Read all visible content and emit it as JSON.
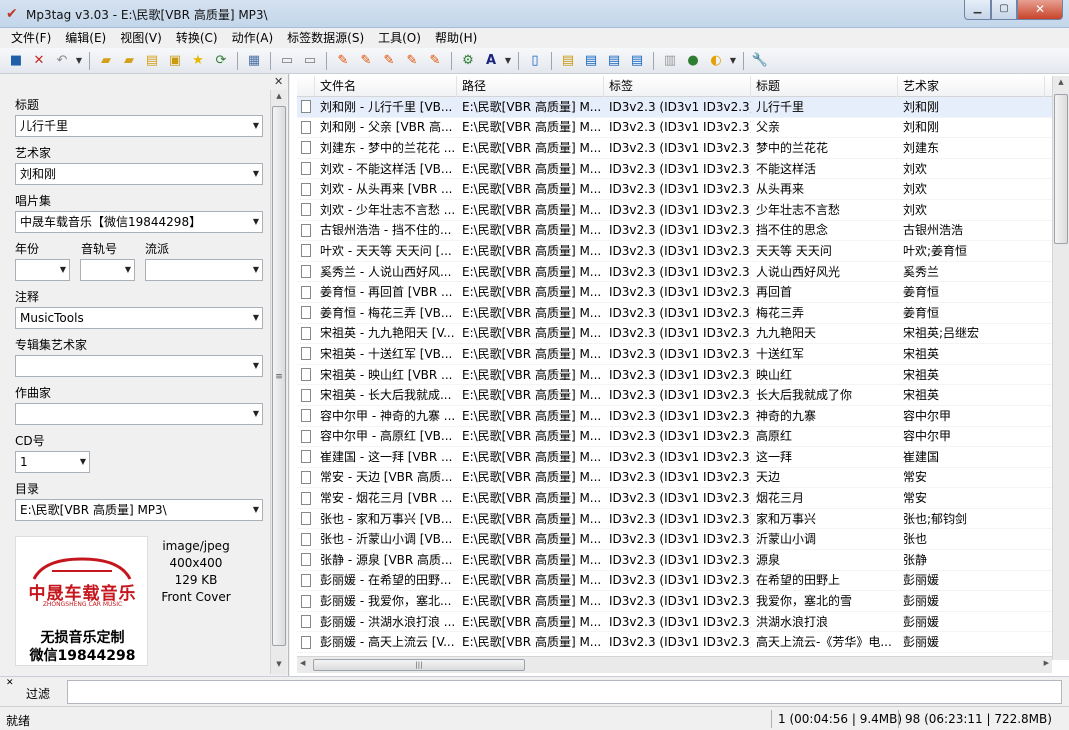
{
  "window": {
    "title": "Mp3tag v3.03 - E:\\民歌[VBR 高质量] MP3\\",
    "icon": "mp3tag-check-icon"
  },
  "menu": [
    "文件(F)",
    "编辑(E)",
    "视图(V)",
    "转换(C)",
    "动作(A)",
    "标签数据源(S)",
    "工具(O)",
    "帮助(H)"
  ],
  "toolbar": {
    "icons": [
      "save-icon",
      "remove-tag-icon",
      "undo-icon",
      "open-folder-icon",
      "add-folder-icon",
      "save-playlist-icon",
      "favorites-icon",
      "refresh-icon",
      "columns-icon",
      "tag-filename-icon",
      "filename-tag-icon",
      "text-file-tag-icon",
      "tag-text-icon",
      "actions-icon",
      "auto-numbering-icon",
      "case-conversion-icon",
      "export-icon",
      "tag-sources-icon",
      "freedb-icon",
      "amazon-icon",
      "discogs-icon",
      "print-icon",
      "web-icon",
      "musicbrainz-icon",
      "settings-icon"
    ]
  },
  "tag_panel": {
    "title_label": "标题",
    "title_value": "儿行千里",
    "artist_label": "艺术家",
    "artist_value": "刘和刚",
    "album_label": "唱片集",
    "album_value": "中晟车载音乐【微信19844298】",
    "year_label": "年份",
    "year_value": "",
    "track_label": "音轨号",
    "track_value": "",
    "genre_label": "流派",
    "genre_value": "",
    "comment_label": "注释",
    "comment_value": "MusicTools",
    "album_artist_label": "专辑集艺术家",
    "album_artist_value": "",
    "composer_label": "作曲家",
    "composer_value": "",
    "disc_label": "CD号",
    "disc_value": "1",
    "dir_label": "目录",
    "dir_value": "E:\\民歌[VBR 高质量] MP3\\",
    "cover": {
      "brand": "中晟车载音乐",
      "brand_sub": "ZHONGSHENG CAR MUSIC",
      "line1": "无损音乐定制",
      "line2": "微信19844298",
      "mime": "image/jpeg",
      "dimensions": "400x400",
      "size": "129 KB",
      "type": "Front Cover"
    }
  },
  "file_list": {
    "columns": [
      "文件名",
      "路径",
      "标签",
      "标题",
      "艺术家"
    ],
    "rows": [
      {
        "file": "刘和刚 - 儿行千里 [VB...",
        "path": "E:\\民歌[VBR 高质量] M...",
        "tag": "ID3v2.3 (ID3v1 ID3v2.3)",
        "title": "儿行千里",
        "artist": "刘和刚",
        "selected": true
      },
      {
        "file": "刘和刚 - 父亲 [VBR 高...",
        "path": "E:\\民歌[VBR 高质量] M...",
        "tag": "ID3v2.3 (ID3v1 ID3v2.3)",
        "title": "父亲",
        "artist": "刘和刚"
      },
      {
        "file": "刘建东 - 梦中的兰花花 ...",
        "path": "E:\\民歌[VBR 高质量] M...",
        "tag": "ID3v2.3 (ID3v1 ID3v2.3)",
        "title": "梦中的兰花花",
        "artist": "刘建东"
      },
      {
        "file": "刘欢 - 不能这样活 [VB...",
        "path": "E:\\民歌[VBR 高质量] M...",
        "tag": "ID3v2.3 (ID3v1 ID3v2.3)",
        "title": "不能这样活",
        "artist": "刘欢"
      },
      {
        "file": "刘欢 - 从头再来 [VBR ...",
        "path": "E:\\民歌[VBR 高质量] M...",
        "tag": "ID3v2.3 (ID3v1 ID3v2.3)",
        "title": "从头再来",
        "artist": "刘欢"
      },
      {
        "file": "刘欢 - 少年壮志不言愁 ...",
        "path": "E:\\民歌[VBR 高质量] M...",
        "tag": "ID3v2.3 (ID3v1 ID3v2.3)",
        "title": "少年壮志不言愁",
        "artist": "刘欢"
      },
      {
        "file": "古银州浩浩 - 挡不住的...",
        "path": "E:\\民歌[VBR 高质量] M...",
        "tag": "ID3v2.3 (ID3v1 ID3v2.3)",
        "title": "挡不住的思念",
        "artist": "古银州浩浩"
      },
      {
        "file": "叶欢 - 天天等 天天问 [...",
        "path": "E:\\民歌[VBR 高质量] M...",
        "tag": "ID3v2.3 (ID3v1 ID3v2.3)",
        "title": "天天等 天天问",
        "artist": "叶欢;姜育恒"
      },
      {
        "file": "奚秀兰 - 人说山西好风...",
        "path": "E:\\民歌[VBR 高质量] M...",
        "tag": "ID3v2.3 (ID3v1 ID3v2.3)",
        "title": "人说山西好风光",
        "artist": "奚秀兰"
      },
      {
        "file": "姜育恒 - 再回首 [VBR ...",
        "path": "E:\\民歌[VBR 高质量] M...",
        "tag": "ID3v2.3 (ID3v1 ID3v2.3)",
        "title": "再回首",
        "artist": "姜育恒"
      },
      {
        "file": "姜育恒 - 梅花三弄 [VB...",
        "path": "E:\\民歌[VBR 高质量] M...",
        "tag": "ID3v2.3 (ID3v1 ID3v2.3)",
        "title": "梅花三弄",
        "artist": "姜育恒"
      },
      {
        "file": "宋祖英 - 九九艳阳天 [V...",
        "path": "E:\\民歌[VBR 高质量] M...",
        "tag": "ID3v2.3 (ID3v1 ID3v2.3)",
        "title": "九九艳阳天",
        "artist": "宋祖英;吕继宏"
      },
      {
        "file": "宋祖英 - 十送红军 [VB...",
        "path": "E:\\民歌[VBR 高质量] M...",
        "tag": "ID3v2.3 (ID3v1 ID3v2.3)",
        "title": "十送红军",
        "artist": "宋祖英"
      },
      {
        "file": "宋祖英 - 映山红 [VBR ...",
        "path": "E:\\民歌[VBR 高质量] M...",
        "tag": "ID3v2.3 (ID3v1 ID3v2.3)",
        "title": "映山红",
        "artist": "宋祖英"
      },
      {
        "file": "宋祖英 - 长大后我就成...",
        "path": "E:\\民歌[VBR 高质量] M...",
        "tag": "ID3v2.3 (ID3v1 ID3v2.3)",
        "title": "长大后我就成了你",
        "artist": "宋祖英"
      },
      {
        "file": "容中尔甲 - 神奇的九寨 ...",
        "path": "E:\\民歌[VBR 高质量] M...",
        "tag": "ID3v2.3 (ID3v1 ID3v2.3)",
        "title": "神奇的九寨",
        "artist": "容中尔甲"
      },
      {
        "file": "容中尔甲 - 高原红 [VB...",
        "path": "E:\\民歌[VBR 高质量] M...",
        "tag": "ID3v2.3 (ID3v1 ID3v2.3)",
        "title": "高原红",
        "artist": "容中尔甲"
      },
      {
        "file": "崔建国 - 这一拜 [VBR ...",
        "path": "E:\\民歌[VBR 高质量] M...",
        "tag": "ID3v2.3 (ID3v1 ID3v2.3)",
        "title": "这一拜",
        "artist": "崔建国"
      },
      {
        "file": "常安 - 天边 [VBR 高质...",
        "path": "E:\\民歌[VBR 高质量] M...",
        "tag": "ID3v2.3 (ID3v1 ID3v2.3)",
        "title": "天边",
        "artist": "常安"
      },
      {
        "file": "常安 - 烟花三月 [VBR ...",
        "path": "E:\\民歌[VBR 高质量] M...",
        "tag": "ID3v2.3 (ID3v1 ID3v2.3)",
        "title": "烟花三月",
        "artist": "常安"
      },
      {
        "file": "张也 - 家和万事兴 [VB...",
        "path": "E:\\民歌[VBR 高质量] M...",
        "tag": "ID3v2.3 (ID3v1 ID3v2.3)",
        "title": "家和万事兴",
        "artist": "张也;郁钧剑"
      },
      {
        "file": "张也 - 沂蒙山小调 [VB...",
        "path": "E:\\民歌[VBR 高质量] M...",
        "tag": "ID3v2.3 (ID3v1 ID3v2.3)",
        "title": "沂蒙山小调",
        "artist": "张也"
      },
      {
        "file": "张静 - 源泉 [VBR 高质...",
        "path": "E:\\民歌[VBR 高质量] M...",
        "tag": "ID3v2.3 (ID3v1 ID3v2.3)",
        "title": "源泉",
        "artist": "张静"
      },
      {
        "file": "彭丽媛 - 在希望的田野...",
        "path": "E:\\民歌[VBR 高质量] M...",
        "tag": "ID3v2.3 (ID3v1 ID3v2.3)",
        "title": "在希望的田野上",
        "artist": "彭丽媛"
      },
      {
        "file": "彭丽媛 - 我爱你，塞北...",
        "path": "E:\\民歌[VBR 高质量] M...",
        "tag": "ID3v2.3 (ID3v1 ID3v2.3)",
        "title": "我爱你，塞北的雪",
        "artist": "彭丽媛"
      },
      {
        "file": "彭丽媛 - 洪湖水浪打浪 ...",
        "path": "E:\\民歌[VBR 高质量] M...",
        "tag": "ID3v2.3 (ID3v1 ID3v2.3)",
        "title": "洪湖水浪打浪",
        "artist": "彭丽媛"
      },
      {
        "file": "彭丽媛 - 高天上流云 [V...",
        "path": "E:\\民歌[VBR 高质量] M...",
        "tag": "ID3v2.3 (ID3v1 ID3v2.3)",
        "title": "高天上流云-《芳华》电...",
        "artist": "彭丽媛"
      }
    ]
  },
  "filter": {
    "label": "过滤",
    "value": ""
  },
  "status": {
    "left": "就绪",
    "selection": "1 (00:04:56 | 9.4MB)",
    "total": "98 (06:23:11 | 722.8MB)"
  },
  "colors": {
    "selection": "#e6eefb",
    "close_button": "#c7432a",
    "cover_brand": "#c4161c"
  }
}
